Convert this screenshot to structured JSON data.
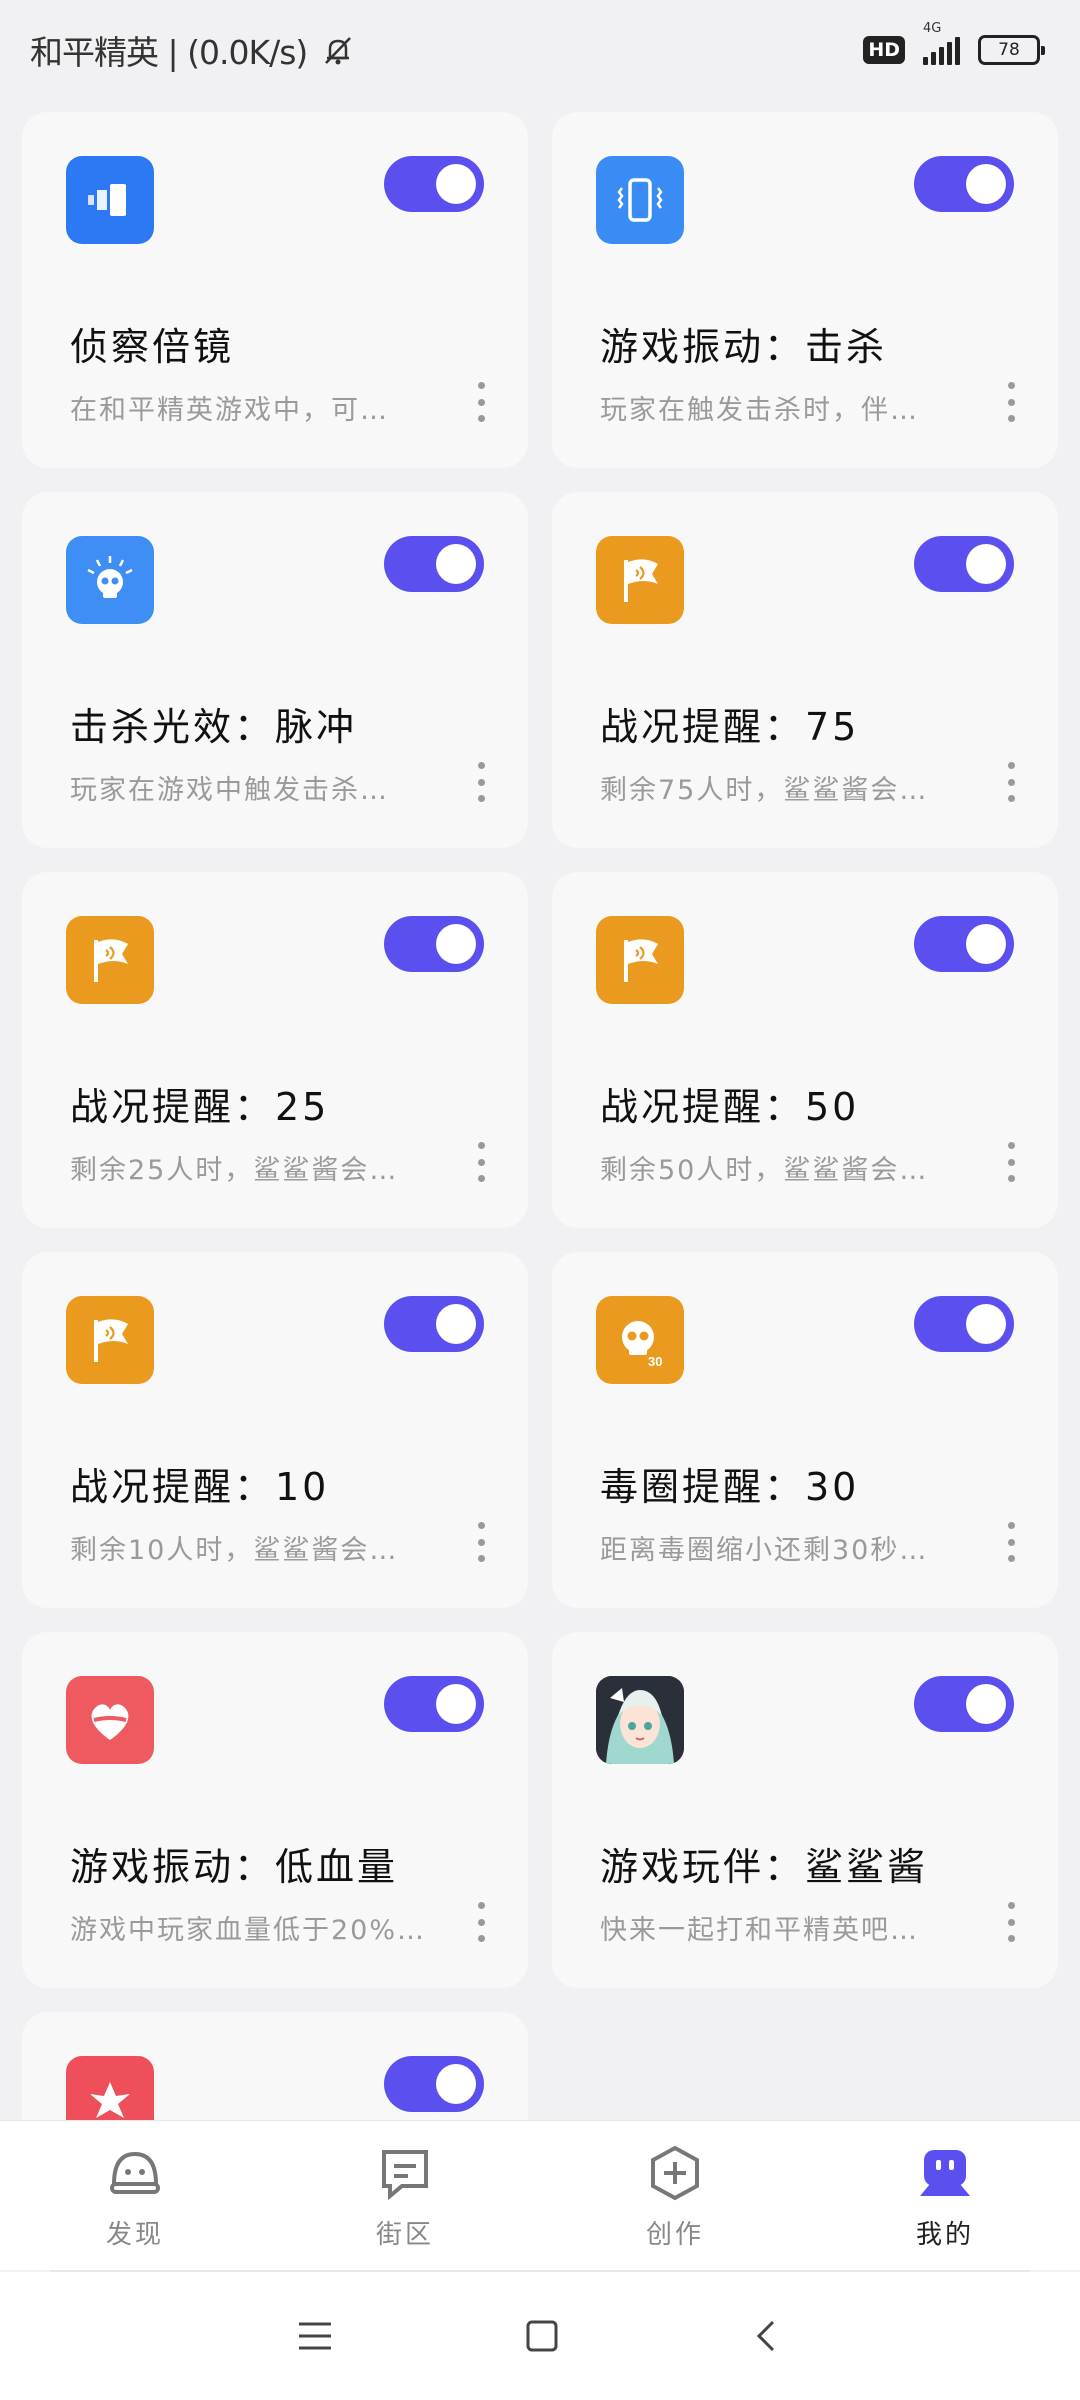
{
  "status": {
    "left_text": "和平精英 | (0.0K/s)",
    "network": "4G",
    "battery": "78"
  },
  "cards": [
    {
      "title": "侦察倍镜",
      "desc": "在和平精英游戏中，可…",
      "icon": "scope-icon",
      "icon_bg": "#2d79f4",
      "enabled": true
    },
    {
      "title": "游戏振动：击杀",
      "desc": "玩家在触发击杀时，伴…",
      "icon": "phone-vibrate-icon",
      "icon_bg": "#3b8bf5",
      "enabled": true
    },
    {
      "title": "击杀光效：脉冲",
      "desc": "玩家在游戏中触发击杀…",
      "icon": "skull-glow-icon",
      "icon_bg": "#3f8ef6",
      "enabled": true
    },
    {
      "title": "战况提醒：75",
      "desc": "剩余75人时，鲨鲨酱会…",
      "icon": "flag-icon",
      "icon_bg": "#ea9a1f",
      "enabled": true
    },
    {
      "title": "战况提醒：25",
      "desc": "剩余25人时，鲨鲨酱会…",
      "icon": "flag-icon",
      "icon_bg": "#ea9a1f",
      "enabled": true
    },
    {
      "title": "战况提醒：50",
      "desc": "剩余50人时，鲨鲨酱会…",
      "icon": "flag-icon",
      "icon_bg": "#ea9a1f",
      "enabled": true
    },
    {
      "title": "战况提醒：10",
      "desc": "剩余10人时，鲨鲨酱会…",
      "icon": "flag-icon",
      "icon_bg": "#ea9a1f",
      "enabled": true
    },
    {
      "title": "毒圈提醒：30",
      "desc": "距离毒圈缩小还剩30秒…",
      "icon": "skull-30-icon",
      "icon_bg": "#ea9a1f",
      "enabled": true
    },
    {
      "title": "游戏振动：低血量",
      "desc": "游戏中玩家血量低于20%…",
      "icon": "heart-icon",
      "icon_bg": "#ee5a5f",
      "enabled": true
    },
    {
      "title": "游戏玩伴：鲨鲨酱",
      "desc": "快来一起打和平精英吧…",
      "icon": "avatar-icon",
      "icon_bg": "#2a2f3a",
      "enabled": true
    },
    {
      "title": "",
      "desc": "",
      "icon": "burst-icon",
      "icon_bg": "#ef4f5a",
      "enabled": true
    }
  ],
  "nav": [
    {
      "label": "发现",
      "icon": "discover-icon",
      "active": false
    },
    {
      "label": "街区",
      "icon": "community-icon",
      "active": false
    },
    {
      "label": "创作",
      "icon": "create-icon",
      "active": false
    },
    {
      "label": "我的",
      "icon": "profile-robot-icon",
      "active": true
    }
  ],
  "colors": {
    "accent": "#5b4ff0",
    "background": "#f1f1f3",
    "card": "#f8f8f9"
  }
}
